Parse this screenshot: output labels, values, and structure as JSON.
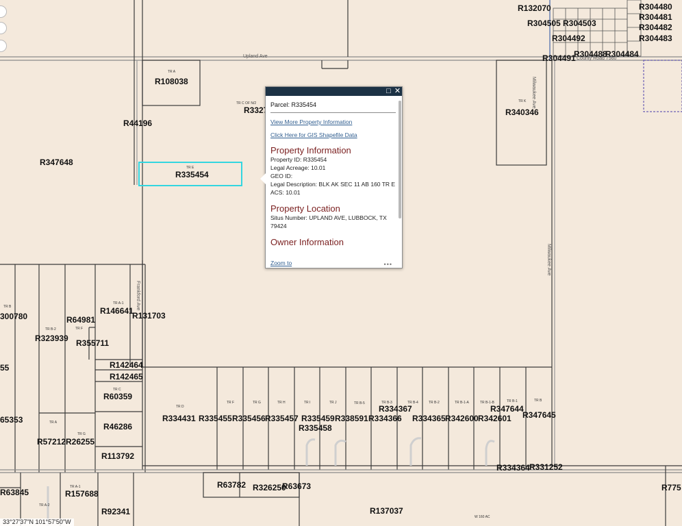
{
  "map": {
    "coordinates": "33°27'37\"N 101°57'50\"W",
    "colors": {
      "background": "#f4e9dc",
      "line": "#3a3a3a",
      "selection": "#33d6e0",
      "popup_header": "#1c3245",
      "section_heading": "#7a1f1f",
      "link": "#2f5d8f"
    },
    "zoom_controls": [
      "zoom-in-icon",
      "zoom-out-icon",
      "home-icon"
    ]
  },
  "parcels": [
    {
      "id": "R132070"
    },
    {
      "id": "R304480"
    },
    {
      "id": "R304481"
    },
    {
      "id": "R304505"
    },
    {
      "id": "R304503"
    },
    {
      "id": "R304482"
    },
    {
      "id": "R304492"
    },
    {
      "id": "R304483"
    },
    {
      "id": "R304488"
    },
    {
      "id": "R304484"
    },
    {
      "id": "R304491"
    },
    {
      "id": "R108038"
    },
    {
      "id": "R3327"
    },
    {
      "id": "R340346"
    },
    {
      "id": "R44196"
    },
    {
      "id": "R347648"
    },
    {
      "id": "R335454"
    },
    {
      "id": "300780"
    },
    {
      "id": "R64981"
    },
    {
      "id": "R146641"
    },
    {
      "id": "R131703"
    },
    {
      "id": "R323939"
    },
    {
      "id": "R355711"
    },
    {
      "id": "R142464"
    },
    {
      "id": "R142465"
    },
    {
      "id": "55"
    },
    {
      "id": "R60359"
    },
    {
      "id": "65353"
    },
    {
      "id": "R46286"
    },
    {
      "id": "R57212"
    },
    {
      "id": "R26255"
    },
    {
      "id": "R113792"
    },
    {
      "id": "R334431"
    },
    {
      "id": "R335455"
    },
    {
      "id": "R335456"
    },
    {
      "id": "R335457"
    },
    {
      "id": "R335459"
    },
    {
      "id": "R338591"
    },
    {
      "id": "R334367"
    },
    {
      "id": "R334366"
    },
    {
      "id": "R334365"
    },
    {
      "id": "R342600"
    },
    {
      "id": "R342601"
    },
    {
      "id": "R347644"
    },
    {
      "id": "R347645"
    },
    {
      "id": "R335458"
    },
    {
      "id": "R334364"
    },
    {
      "id": "R331252"
    },
    {
      "id": "R63845"
    },
    {
      "id": "R157688"
    },
    {
      "id": "R63782"
    },
    {
      "id": "R326250"
    },
    {
      "id": "R63673"
    },
    {
      "id": "R137037"
    },
    {
      "id": "R92341"
    },
    {
      "id": "R775"
    }
  ],
  "tract_labels": [
    "TR A",
    "TR C OF N/2",
    "TR K",
    "TR E",
    "TR B",
    "TR B-2",
    "TR F",
    "TR A-1",
    "TR C",
    "TR A",
    "TR G",
    "TR D",
    "TR F",
    "TR G",
    "TR H",
    "TR I",
    "TR J",
    "TR B-5",
    "TR B-3",
    "TR B-4",
    "TR B-2",
    "TR B-1-A",
    "TR B-1-B",
    "TR B-1",
    "TR B",
    "TR A-2",
    "TR A-1",
    "W 160 AC"
  ],
  "roads": [
    "Milwaukee Ave",
    "Milwaukee Ave",
    "Upland Ave",
    "County Road 7560",
    "Frankford Ave"
  ],
  "popup": {
    "parcel_title": "Parcel: R335454",
    "link_more": "View More Property Information",
    "link_gis": "Click Here for GIS Shapefile Data",
    "section_property": "Property Information",
    "property_id_label": "Property ID:",
    "property_id": "R335454",
    "legal_acreage_label": "Legal Acreage:",
    "legal_acreage": "10.01",
    "geo_id_label": "GEO ID:",
    "geo_id": "",
    "legal_desc_label": "Legal Description:",
    "legal_desc": "BLK AK SEC 11 AB 160 TR E ACS: 10.01",
    "section_location": "Property Location",
    "situs_label": "Situs Number:",
    "situs": "UPLAND AVE, LUBBOCK, TX 79424",
    "section_owner": "Owner Information",
    "zoom_to": "Zoom to",
    "more_dots": "•••",
    "maximize_icon": "maximize-icon",
    "close_icon": "close-icon"
  }
}
